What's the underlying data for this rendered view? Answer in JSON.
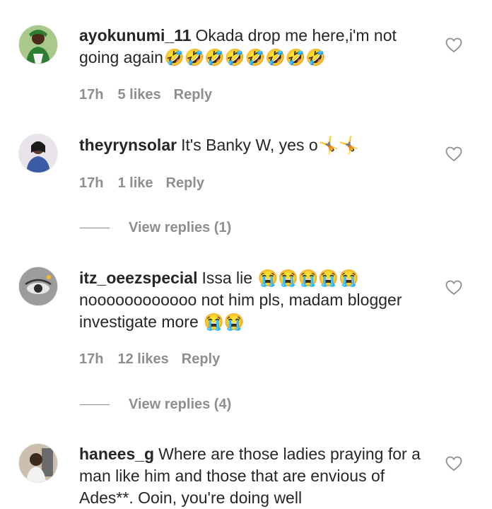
{
  "comments": [
    {
      "username": "ayokunumi_11",
      "text": "Okada drop me here,i'm not going again",
      "emojis": "🤣🤣🤣🤣🤣🤣🤣🤣",
      "time": "17h",
      "likes": "5 likes",
      "reply": "Reply"
    },
    {
      "username": "theyrynsolar",
      "text": "It's Banky W, yes o",
      "emojis": "🤸🤸",
      "time": "17h",
      "likes": "1 like",
      "reply": "Reply",
      "view_replies": "View replies (1)"
    },
    {
      "username": "itz_oeezspecial",
      "text": "Issa lie",
      "emojis": "😭😭😭😭😭",
      "text2": "noooooooooooo not him pls, madam blogger investigate more",
      "emojis2": "😭😭",
      "time": "17h",
      "likes": "12 likes",
      "reply": "Reply",
      "view_replies": "View replies (4)"
    },
    {
      "username": "hanees_g",
      "text": "Where are those ladies praying for a man like him and those that are envious of Ades**. Ooin, you're doing well"
    }
  ]
}
